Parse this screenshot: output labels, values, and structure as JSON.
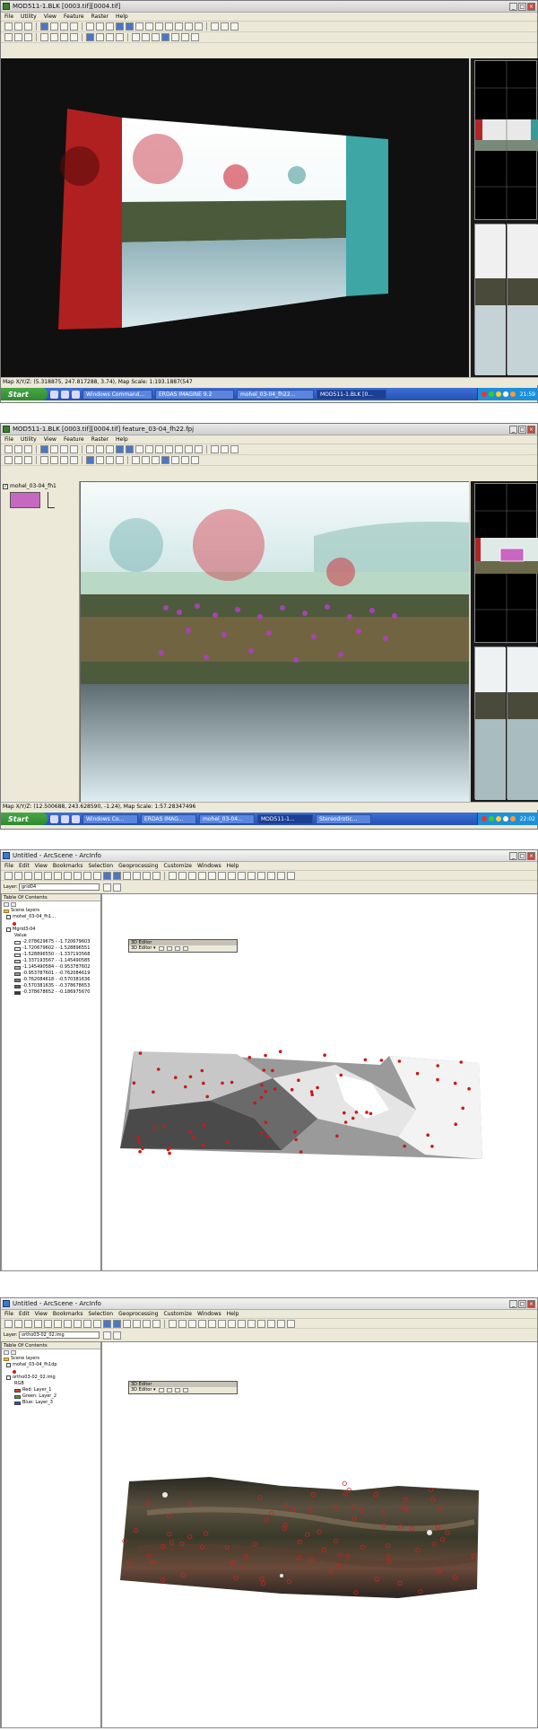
{
  "panel1": {
    "title": "MOD511-1.BLK [0003.tif][0004.tif]",
    "menu": [
      "File",
      "Utility",
      "View",
      "Feature",
      "Raster",
      "Help"
    ],
    "status": "Map X/Y/Z: (5.318875, 247.817288, 3.74), Map Scale: 1:193.1887(547",
    "taskbar": {
      "start": "Start",
      "tasks": [
        "Windows Command...",
        "ERDAS IMAGINE 9.2",
        "mohel_03-04_fh22...",
        "MOD511-1.BLK [0..."
      ],
      "clock": "21:59"
    }
  },
  "panel2": {
    "title": "MOD511-1.BLK [0003.tif][0004.tif]  feature_03-04_fh22.fpj",
    "menu": [
      "File",
      "Utility",
      "View",
      "Feature",
      "Raster",
      "Help"
    ],
    "layer_label": "mohel_03-04_fh1",
    "status": "Map X/Y/Z: (12.500688, 243.628590, -1.24), Map Scale: 1:57.28347496",
    "taskbar": {
      "start": "Start",
      "tasks": [
        "Windows Co...",
        "ERDAS IMAG...",
        "mohel_03-04...",
        "MOD511-1...",
        "Stereodrotic..."
      ],
      "clock": "22:02"
    }
  },
  "panel3": {
    "title": "Untitled - ArcScene - ArcInfo",
    "menu": [
      "File",
      "Edit",
      "View",
      "Bookmarks",
      "Selection",
      "Geoprocessing",
      "Customize",
      "Windows",
      "Help"
    ],
    "layer_dropdown_label": "Layer:",
    "layer_dropdown_value": "grid04",
    "toc_title": "Table Of Contents",
    "toc": {
      "scene_layers": "Scene layers",
      "layer1": "mohel_03-04_fh1...",
      "layer2": "Mgrid3-04",
      "value_label": "Value",
      "classes": [
        "-2.078629675 - -1.720679603",
        "-1.720679602 - -1.528896551",
        "-1.528896550 - -1.337193568",
        "-1.337193567 - -1.145490585",
        "-1.145490584 - -0.953787602",
        "-0.953787601 - -0.762084619",
        "-0.762084618 - -0.570381636",
        "-0.570381635 - -0.378678653",
        "-0.378678652 - -0.186975670"
      ],
      "class_colors": [
        "#ffffff",
        "#f0f0f0",
        "#dedede",
        "#c9c9c9",
        "#b3b3b3",
        "#9a9a9a",
        "#7c7c7c",
        "#5c5c5c",
        "#3a3a3a"
      ]
    },
    "editor_title": "3D Editor",
    "editor_menu": "3D Editor ▾"
  },
  "panel4": {
    "title": "Untitled - ArcScene - ArcInfo",
    "menu": [
      "File",
      "Edit",
      "View",
      "Bookmarks",
      "Selection",
      "Geoprocessing",
      "Customize",
      "Windows",
      "Help"
    ],
    "layer_dropdown_label": "Layer:",
    "layer_dropdown_value": "ortho03-02_02.img",
    "toc_title": "Table Of Contents",
    "toc": {
      "scene_layers": "Scene layers",
      "layer1": "mohel_03-04_fh1dp",
      "layer2": "ortho03-02_02.img",
      "rgb": "RGB",
      "bands": [
        {
          "label": "Red:   Layer_1",
          "color": "#e03a2a"
        },
        {
          "label": "Green: Layer_2",
          "color": "#3aa63a"
        },
        {
          "label": "Blue:  Layer_3",
          "color": "#2a4ad0"
        }
      ]
    },
    "editor_title": "3D Editor",
    "editor_menu": "3D Editor ▾"
  }
}
